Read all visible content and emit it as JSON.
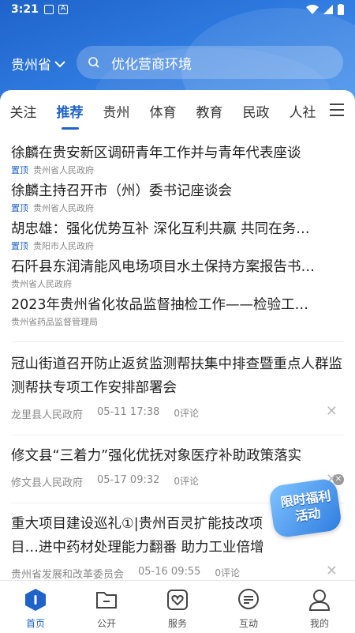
{
  "status": {
    "time": "3:21"
  },
  "header": {
    "region": "贵州省",
    "search_text": "优化营商环境"
  },
  "tabs": [
    "关注",
    "推荐",
    "贵州",
    "体育",
    "教育",
    "民政",
    "人社"
  ],
  "top_items": [
    {
      "title": "徐麟在贵安新区调研青年工作并与青年代表座谈",
      "pin": "置顶",
      "source": "贵州省人民政府"
    },
    {
      "title": "徐麟主持召开市（州）委书记座谈会",
      "pin": "置顶",
      "source": "贵州省人民政府"
    },
    {
      "title": "胡忠雄：强化优势互补 深化互利共赢 共同在务…",
      "pin": "置顶",
      "source": "贵阳市人民政府"
    },
    {
      "title": "石阡县东润清能风电场项目水土保持方案报告书…",
      "pin": "",
      "source": "贵州省人民政府"
    },
    {
      "title": "2023年贵州省化妆品监督抽检工作——检验工…",
      "pin": "",
      "source": "贵州省药品监督管理局"
    }
  ],
  "articles": [
    {
      "title": "冠山街道召开防止返贫监测帮扶集中排查暨重点人群监测帮扶专项工作安排部署会",
      "source": "龙里县人民政府",
      "time": "05-11 17:38",
      "comments": "0评论"
    },
    {
      "title": "修文县“三着力”强化优抚对象医疗补助政策落实",
      "source": "修文县人民政府",
      "time": "05-17 09:32",
      "comments": "0评论"
    },
    {
      "title": "重大项目建设巡礼①|贵州百灵扩能技改项目…进中药材处理能力翻番 助力工业倍增",
      "source": "贵州省发展和改革委员会",
      "time": "05-16 09:55",
      "comments": "0评论"
    }
  ],
  "promo": {
    "text": "限时福利活动"
  },
  "nav": [
    {
      "label": "首页",
      "icon": "home-icon"
    },
    {
      "label": "公开",
      "icon": "folder-icon"
    },
    {
      "label": "服务",
      "icon": "heart-service-icon"
    },
    {
      "label": "互动",
      "icon": "chat-icon"
    },
    {
      "label": "我的",
      "icon": "user-icon"
    }
  ],
  "colors": {
    "accent": "#1f63c9",
    "text": "#222222",
    "meta": "#888888"
  }
}
